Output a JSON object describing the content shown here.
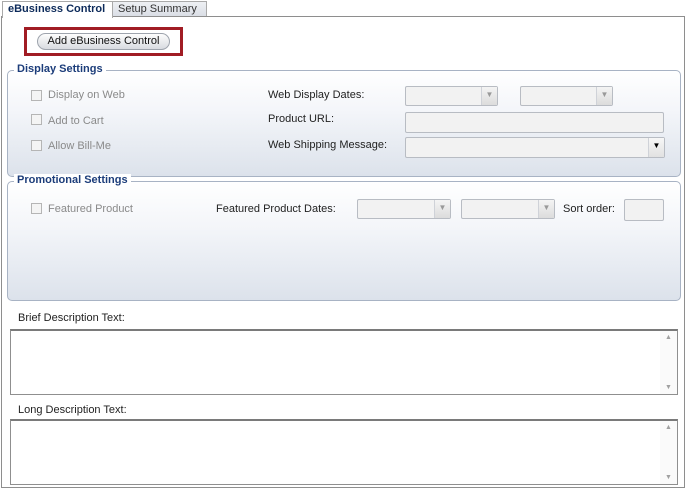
{
  "tabs": [
    {
      "label": "eBusiness Control",
      "active": true
    },
    {
      "label": "Setup Summary",
      "active": false
    }
  ],
  "toolbar": {
    "add_button": "Add eBusiness Control"
  },
  "display_settings": {
    "legend": "Display Settings",
    "checkboxes": {
      "display_on_web": "Display on Web",
      "add_to_cart": "Add to Cart",
      "allow_bill_me": "Allow Bill-Me"
    },
    "web_display_dates_label": "Web Display Dates:",
    "product_url_label": "Product URL:",
    "web_shipping_message_label": "Web Shipping Message:",
    "product_url_value": "",
    "web_shipping_message_value": ""
  },
  "promotional_settings": {
    "legend": "Promotional Settings",
    "featured_product_label": "Featured Product",
    "featured_product_dates_label": "Featured Product Dates:",
    "sort_order_label": "Sort order:",
    "sort_order_value": ""
  },
  "brief_description": {
    "label": "Brief Description Text:",
    "value": ""
  },
  "long_description": {
    "label": "Long Description Text:",
    "value": ""
  },
  "icons": {
    "dropdown": "chevron-down-icon",
    "scroll_up": "scroll-up-arrow-icon",
    "scroll_down": "scroll-down-arrow-icon"
  },
  "colors": {
    "highlight": "#a11c24",
    "legend_text": "#1c3d7a",
    "tab_active_text": "#0c2a5a"
  }
}
